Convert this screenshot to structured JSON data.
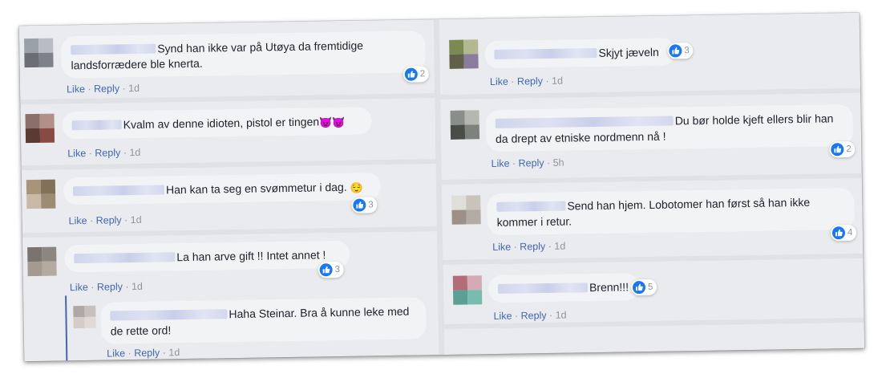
{
  "thumbs": [
    "like-thumb-icon"
  ],
  "left_column": [
    {
      "text": "Synd han ikke var på Utøya da fremtidige landsforrædere ble knerta.",
      "like": "Like",
      "reply": "Reply",
      "time": "1d",
      "reactions": "2",
      "avatar": [
        "#9aa0a8",
        "#b8bcc4",
        "#6b6e75",
        "#7d8189"
      ]
    },
    {
      "text": "Kvalm av denne idioten, pistol er tingen",
      "emoji": "👿👿",
      "like": "Like",
      "reply": "Reply",
      "time": "1d",
      "reactions": "",
      "avatar": [
        "#8a7068",
        "#b09088",
        "#5c3a34",
        "#8a4a44"
      ]
    },
    {
      "text": "Han kan ta seg en svømmetur i dag.",
      "emoji": "😌",
      "like": "Like",
      "reply": "Reply",
      "time": "1d",
      "reactions": "3",
      "avatar": [
        "#a89478",
        "#827058",
        "#c8baa4",
        "#9c8c74"
      ]
    },
    {
      "text": "La han arve gift !! Intet annet !",
      "like": "Like",
      "reply": "Reply",
      "time": "1d",
      "reactions": "3",
      "avatar": [
        "#7a7470",
        "#8c8680",
        "#a49a90",
        "#b4aaa0"
      ]
    },
    {
      "text": "Haha Steinar. Bra å kunne leke med de rette ord!",
      "like": "Like",
      "reply": "Reply",
      "time": "1d",
      "reactions": "",
      "avatar": [
        "#b0a8a4",
        "#c8c0bc",
        "#d4ccc8",
        "#e0dad6"
      ]
    }
  ],
  "right_column": [
    {
      "text": "Skjyt jæveln",
      "like": "Like",
      "reply": "Reply",
      "time": "1d",
      "reactions": "3",
      "avatar": [
        "#7a8a50",
        "#b4b890",
        "#606048",
        "#8a7c9c"
      ]
    },
    {
      "text": "Du bør holde kjeft ellers blir han da drept av etniske nordmenn nå !",
      "like": "Like",
      "reply": "Reply",
      "time": "5h",
      "reactions": "2",
      "avatar": [
        "#8a8e88",
        "#b4b8b0",
        "#4a4c48",
        "#7e827c"
      ]
    },
    {
      "text": "Send han hjem. Lobotomer han først så han ikke kommer i retur.",
      "like": "Like",
      "reply": "Reply",
      "time": "1d",
      "reactions": "4",
      "avatar": [
        "#e0ded8",
        "#c8c4bc",
        "#9c9088",
        "#b4aca4"
      ]
    },
    {
      "text": "Brenn!!!",
      "like": "Like",
      "reply": "Reply",
      "time": "1d",
      "reactions": "5",
      "avatar": [
        "#b46c78",
        "#d4aab4",
        "#5aa094",
        "#78bcb0"
      ]
    }
  ]
}
